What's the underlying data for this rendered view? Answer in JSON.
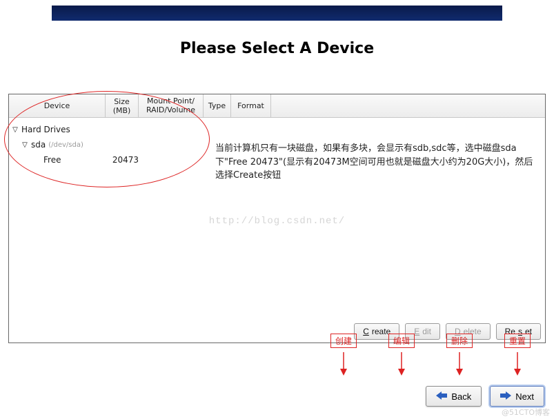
{
  "title": "Please Select A Device",
  "columns": {
    "device": "Device",
    "size": "Size\n(MB)",
    "mount": "Mount Point/\nRAID/Volume",
    "type": "Type",
    "format": "Format"
  },
  "tree": {
    "root_label": "Hard Drives",
    "disk": {
      "name": "sda",
      "path": "(/dev/sda)"
    },
    "free": {
      "label": "Free",
      "size": "20473"
    }
  },
  "overlay_note": "当前计算机只有一块磁盘，如果有多块，会显示有sdb,sdc等，选中磁盘sda下\"Free 20473\"(显示有20473M空间可用也就是磁盘大小约为20G大小)，然后选择Create按钮",
  "watermark": "http://blog.csdn.net/",
  "annotations": [
    {
      "label": "创建"
    },
    {
      "label": "编辑"
    },
    {
      "label": "删除"
    },
    {
      "label": "重置"
    }
  ],
  "panel_buttons": {
    "create": {
      "u": "C",
      "rest": "reate",
      "enabled": true
    },
    "edit": {
      "u": "E",
      "rest": "dit",
      "enabled": false
    },
    "delete": {
      "u": "D",
      "rest": "elete",
      "enabled": false
    },
    "reset": {
      "u": "R",
      "pre": "Re",
      "rest": "et",
      "underline_char": "s",
      "enabled": true
    }
  },
  "nav": {
    "back": {
      "u": "B",
      "rest": "ack"
    },
    "next": {
      "u": "N",
      "rest": "ext"
    }
  },
  "corner_watermark": "@51CTO博客"
}
